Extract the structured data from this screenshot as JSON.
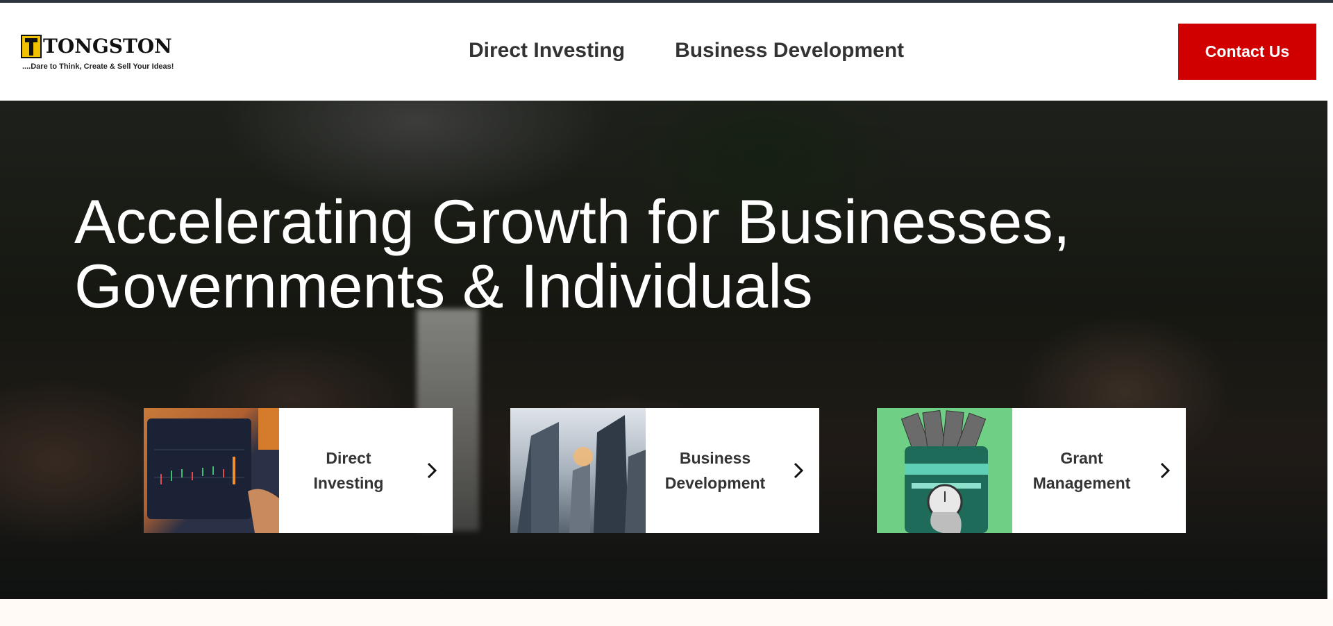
{
  "brand": {
    "name": "TONGSTON",
    "tagline": "....Dare to Think, Create & Sell Your Ideas!",
    "accent": "#d10000",
    "logo_yellow": "#f2c200"
  },
  "nav": {
    "items": [
      {
        "label": "Direct Investing"
      },
      {
        "label": "Business Development"
      }
    ],
    "contact_label": "Contact Us"
  },
  "hero": {
    "title": "Accelerating Growth for Businesses, Governments & Individuals"
  },
  "cards": [
    {
      "label": "Direct\nInvesting",
      "image": "trading-chart-tablet"
    },
    {
      "label": "Business\nDevelopment",
      "image": "skyscrapers"
    },
    {
      "label": "Grant\nManagement",
      "image": "money-card-stopwatch"
    }
  ]
}
